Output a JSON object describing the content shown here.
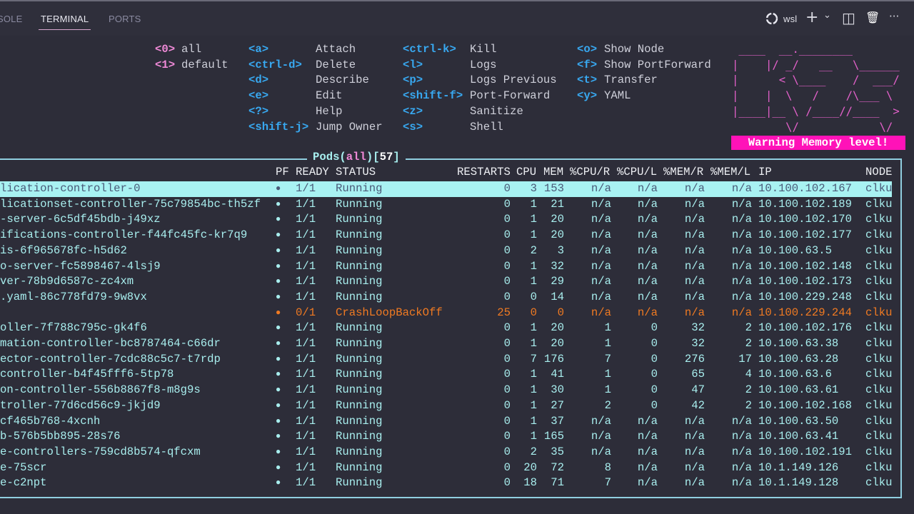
{
  "panel_tabs": [
    {
      "label": "SOLE"
    },
    {
      "label": "TERMINAL"
    },
    {
      "label": "PORTS"
    }
  ],
  "toolbar": {
    "profile": "wsl",
    "add": "+",
    "add_menu": "⌄",
    "split": "◫",
    "trash": "🗑",
    "more": "···"
  },
  "namespaces": [
    {
      "key": "<0>",
      "label": "all"
    },
    {
      "key": "<1>",
      "label": "default"
    }
  ],
  "shortcuts_col1": [
    {
      "key": "<a>",
      "label": "Attach"
    },
    {
      "key": "<ctrl-d>",
      "label": "Delete"
    },
    {
      "key": "<d>",
      "label": "Describe"
    },
    {
      "key": "<e>",
      "label": "Edit"
    },
    {
      "key": "<?>",
      "label": "Help"
    },
    {
      "key": "<shift-j>",
      "label": "Jump Owner"
    }
  ],
  "shortcuts_col2": [
    {
      "key": "<ctrl-k>",
      "label": "Kill"
    },
    {
      "key": "<l>",
      "label": "Logs"
    },
    {
      "key": "<p>",
      "label": "Logs Previous"
    },
    {
      "key": "<shift-f>",
      "label": "Port-Forward"
    },
    {
      "key": "<z>",
      "label": "Sanitize"
    },
    {
      "key": "<s>",
      "label": "Shell"
    }
  ],
  "shortcuts_col3": [
    {
      "key": "<o>",
      "label": "Show Node"
    },
    {
      "key": "<f>",
      "label": "Show PortForward"
    },
    {
      "key": "<t>",
      "label": "Transfer"
    },
    {
      "key": "<y>",
      "label": "YAML"
    }
  ],
  "logo": " ____  __.________       \n|    |/ _/   __   \\______\n|      < \\____    /  ___/\n|    |  \\   /    /\\___ \\ \n|____|__ \\ /____//____  >\n        \\/            \\/ ",
  "warning": "Warning Memory level!",
  "pods": {
    "title_prefix": "Pods(",
    "scope": "all",
    "title_mid": ")[",
    "count": "57",
    "title_suffix": "]"
  },
  "columns": [
    "PF",
    "READY",
    "STATUS",
    "RESTARTS",
    "CPU",
    "MEM",
    "%CPU/R",
    "%CPU/L",
    "%MEM/R",
    "%MEM/L",
    "IP",
    "NODE"
  ],
  "rows": [
    [
      "lication-controller-0",
      "●",
      "1/1",
      "Running",
      "0",
      "3",
      "153",
      "n/a",
      "n/a",
      "n/a",
      "n/a",
      "10.100.102.167",
      "clku"
    ],
    [
      "licationset-controller-75c79854bc-th5zf",
      "●",
      "1/1",
      "Running",
      "0",
      "1",
      "21",
      "n/a",
      "n/a",
      "n/a",
      "n/a",
      "10.100.102.189",
      "clku"
    ],
    [
      "-server-6c5df45bdb-j49xz",
      "●",
      "1/1",
      "Running",
      "0",
      "1",
      "20",
      "n/a",
      "n/a",
      "n/a",
      "n/a",
      "10.100.102.170",
      "clku"
    ],
    [
      "ifications-controller-f44fc45fc-kr7q9",
      "●",
      "1/1",
      "Running",
      "0",
      "1",
      "20",
      "n/a",
      "n/a",
      "n/a",
      "n/a",
      "10.100.102.177",
      "clku"
    ],
    [
      "is-6f965678fc-h5d62",
      "●",
      "1/1",
      "Running",
      "0",
      "2",
      "3",
      "n/a",
      "n/a",
      "n/a",
      "n/a",
      "10.100.63.5",
      "clku"
    ],
    [
      "o-server-fc5898467-4lsj9",
      "●",
      "1/1",
      "Running",
      "0",
      "1",
      "32",
      "n/a",
      "n/a",
      "n/a",
      "n/a",
      "10.100.102.148",
      "clku"
    ],
    [
      "ver-78b9d6587c-zc4xm",
      "●",
      "1/1",
      "Running",
      "0",
      "1",
      "29",
      "n/a",
      "n/a",
      "n/a",
      "n/a",
      "10.100.102.173",
      "clku"
    ],
    [
      ".yaml-86c778fd79-9w8vx",
      "●",
      "1/1",
      "Running",
      "0",
      "0",
      "14",
      "n/a",
      "n/a",
      "n/a",
      "n/a",
      "10.100.229.248",
      "clku"
    ],
    [
      "",
      "●",
      "0/1",
      "CrashLoopBackOff",
      "25",
      "0",
      "0",
      "n/a",
      "n/a",
      "n/a",
      "n/a",
      "10.100.229.244",
      "clku"
    ],
    [
      "oller-7f788c795c-gk4f6",
      "●",
      "1/1",
      "Running",
      "0",
      "1",
      "20",
      "1",
      "0",
      "32",
      "2",
      "10.100.102.176",
      "clku"
    ],
    [
      "mation-controller-bc8787464-c66dr",
      "●",
      "1/1",
      "Running",
      "0",
      "1",
      "20",
      "1",
      "0",
      "32",
      "2",
      "10.100.63.38",
      "clku"
    ],
    [
      "ector-controller-7cdc88c5c7-t7rdp",
      "●",
      "1/1",
      "Running",
      "0",
      "7",
      "176",
      "7",
      "0",
      "276",
      "17",
      "10.100.63.28",
      "clku"
    ],
    [
      "controller-b4f45fff6-5tp78",
      "●",
      "1/1",
      "Running",
      "0",
      "1",
      "41",
      "1",
      "0",
      "65",
      "4",
      "10.100.63.6",
      "clku"
    ],
    [
      "on-controller-556b8867f8-m8g9s",
      "●",
      "1/1",
      "Running",
      "0",
      "1",
      "30",
      "1",
      "0",
      "47",
      "2",
      "10.100.63.61",
      "clku"
    ],
    [
      "troller-77d6cd56c9-jkjd9",
      "●",
      "1/1",
      "Running",
      "0",
      "1",
      "27",
      "2",
      "0",
      "42",
      "2",
      "10.100.102.168",
      "clku"
    ],
    [
      "cf465b768-4xcnh",
      "●",
      "1/1",
      "Running",
      "0",
      "1",
      "37",
      "n/a",
      "n/a",
      "n/a",
      "n/a",
      "10.100.63.50",
      "clku"
    ],
    [
      "b-576b5bb895-28s76",
      "●",
      "1/1",
      "Running",
      "0",
      "1",
      "165",
      "n/a",
      "n/a",
      "n/a",
      "n/a",
      "10.100.63.41",
      "clku"
    ],
    [
      "e-controllers-759cd8b574-qfcxm",
      "●",
      "1/1",
      "Running",
      "0",
      "2",
      "35",
      "n/a",
      "n/a",
      "n/a",
      "n/a",
      "10.100.102.191",
      "clku"
    ],
    [
      "e-75scr",
      "●",
      "1/1",
      "Running",
      "0",
      "20",
      "72",
      "8",
      "n/a",
      "n/a",
      "n/a",
      "10.1.149.126",
      "clku"
    ],
    [
      "e-c2npt",
      "●",
      "1/1",
      "Running",
      "0",
      "18",
      "71",
      "7",
      "n/a",
      "n/a",
      "n/a",
      "10.1.149.128",
      "clku"
    ]
  ],
  "selected_row": 0,
  "error_rows": [
    8
  ],
  "colors": {
    "accent": "#a8f0f0",
    "error": "#f07a22",
    "warning_bg": "#ff12b8",
    "key": "#38a8f0",
    "namespace_key": "#f08ad8"
  }
}
